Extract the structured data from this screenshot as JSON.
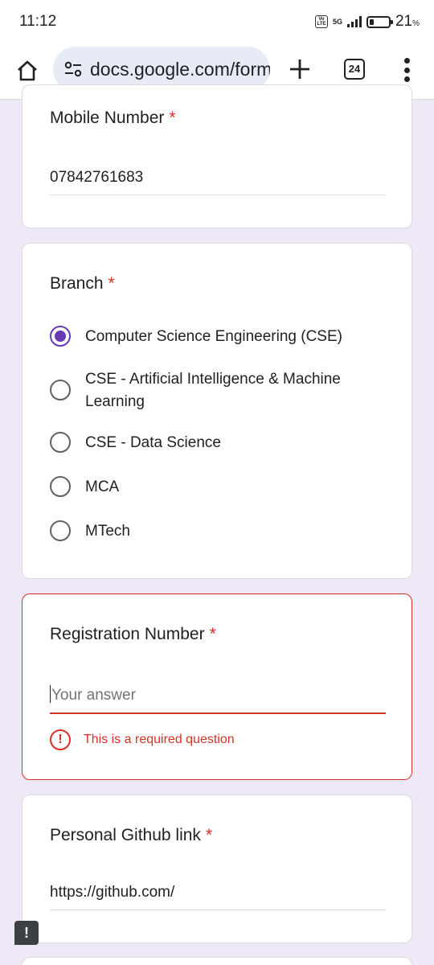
{
  "status_bar": {
    "time": "11:12",
    "volte": "Vo LTE",
    "network": "5G",
    "battery_percent": "21",
    "battery_unit": "%"
  },
  "browser": {
    "url": "docs.google.com/forms/d/e/",
    "tab_count": "24",
    "icons": [
      "home-icon",
      "tune-icon",
      "plus-icon",
      "tabs-icon",
      "more-vert-icon"
    ]
  },
  "form": {
    "mobile": {
      "title": "Mobile Number",
      "required_mark": "*",
      "value": "07842761683"
    },
    "branch": {
      "title": "Branch",
      "required_mark": "*",
      "options": [
        {
          "label": "Computer Science Engineering (CSE)",
          "selected": true
        },
        {
          "label": "CSE - Artificial Intelligence & Machine Learning",
          "selected": false
        },
        {
          "label": "CSE - Data Science",
          "selected": false
        },
        {
          "label": "MCA",
          "selected": false
        },
        {
          "label": "MTech",
          "selected": false
        }
      ]
    },
    "registration": {
      "title": "Registration Number",
      "required_mark": "*",
      "placeholder": "Your answer",
      "error_text": "This is a required question"
    },
    "github": {
      "title": "Personal Github link",
      "required_mark": "*",
      "value": "https://github.com/"
    }
  },
  "feedback": {
    "icon": "!"
  },
  "colors": {
    "background": "#efe9f7",
    "accent": "#673ab7",
    "error": "#d93025"
  }
}
